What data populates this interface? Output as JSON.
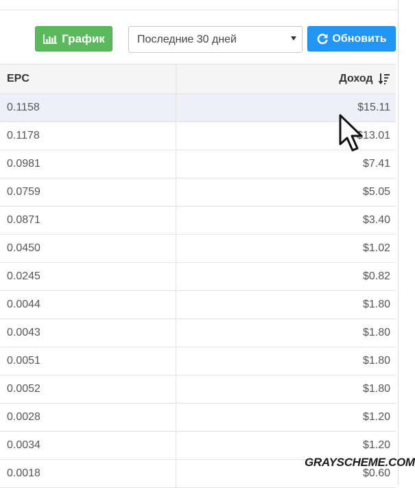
{
  "toolbar": {
    "chart_label": "График",
    "period_value": "Последние 30 дней",
    "refresh_label": "Обновить"
  },
  "table": {
    "headers": {
      "epc": "EPC",
      "income": "Доход"
    },
    "rows": [
      {
        "epc": "0.1158",
        "income": "$15.11"
      },
      {
        "epc": "0.1178",
        "income": "$13.01"
      },
      {
        "epc": "0.0981",
        "income": "$7.41"
      },
      {
        "epc": "0.0759",
        "income": "$5.05"
      },
      {
        "epc": "0.0871",
        "income": "$3.40"
      },
      {
        "epc": "0.0450",
        "income": "$1.02"
      },
      {
        "epc": "0.0245",
        "income": "$0.82"
      },
      {
        "epc": "0.0044",
        "income": "$1.80"
      },
      {
        "epc": "0.0043",
        "income": "$1.80"
      },
      {
        "epc": "0.0051",
        "income": "$1.80"
      },
      {
        "epc": "0.0052",
        "income": "$1.80"
      },
      {
        "epc": "0.0028",
        "income": "$1.20"
      },
      {
        "epc": "0.0034",
        "income": "$1.20"
      },
      {
        "epc": "0.0018",
        "income": "$0.60"
      }
    ]
  },
  "watermark": "GRAYSCHEME.COM",
  "colors": {
    "chart_button": "#5cb85c",
    "refresh_button": "#2196f3",
    "row_highlight": "#eeeff9"
  }
}
